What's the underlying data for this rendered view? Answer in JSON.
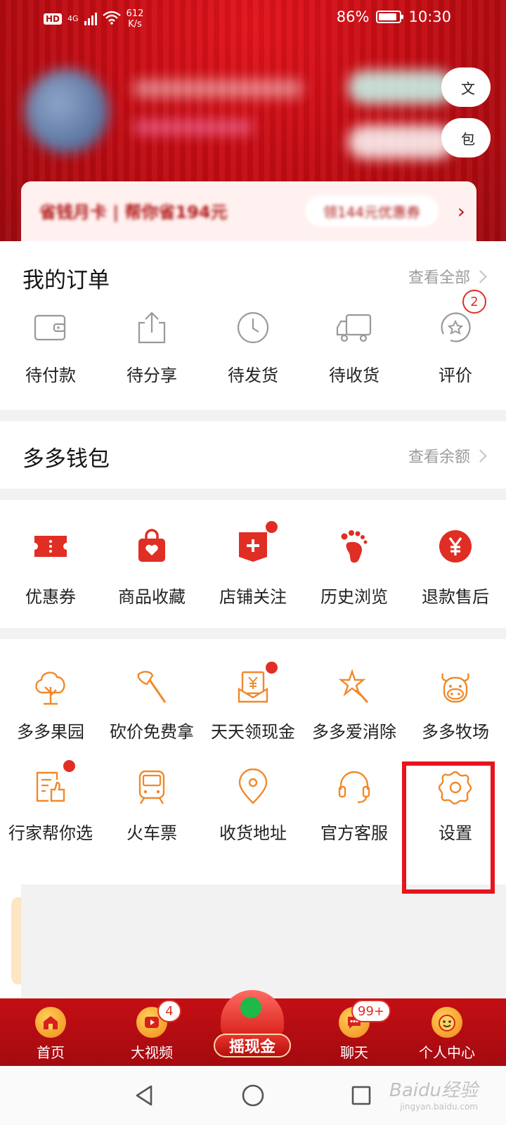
{
  "status_bar": {
    "hd": "HD",
    "network": "4G",
    "speed_value": "612",
    "speed_unit": "K/s",
    "battery": "86%",
    "battery_level": 0.86,
    "time": "10:30"
  },
  "profile": {
    "promo_text": "省钱月卡 | 帮你省194元",
    "promo_button": "领144元优惠券"
  },
  "orders": {
    "title": "我的订单",
    "view_all": "查看全部",
    "items": [
      {
        "label": "待付款",
        "icon": "wallet-icon"
      },
      {
        "label": "待分享",
        "icon": "share-icon"
      },
      {
        "label": "待发货",
        "icon": "clock-icon"
      },
      {
        "label": "待收货",
        "icon": "truck-icon"
      },
      {
        "label": "评价",
        "icon": "review-icon",
        "badge": "2"
      }
    ]
  },
  "wallet": {
    "title": "多多钱包",
    "view_balance": "查看余额"
  },
  "quick_links": [
    {
      "label": "优惠券",
      "icon": "coupon-icon"
    },
    {
      "label": "商品收藏",
      "icon": "favorites-bag-icon"
    },
    {
      "label": "店铺关注",
      "icon": "store-follow-icon",
      "dot": true
    },
    {
      "label": "历史浏览",
      "icon": "footprint-icon"
    },
    {
      "label": "退款售后",
      "icon": "refund-icon"
    }
  ],
  "services": [
    {
      "label": "多多果园",
      "icon": "tree-icon"
    },
    {
      "label": "砍价免费拿",
      "icon": "axe-icon"
    },
    {
      "label": "天天领现金",
      "icon": "cash-envelope-icon",
      "dot": true
    },
    {
      "label": "多多爱消除",
      "icon": "star-wand-icon"
    },
    {
      "label": "多多牧场",
      "icon": "cow-icon"
    },
    {
      "label": "行家帮你选",
      "icon": "thumbs-up-doc-icon",
      "dot": true
    },
    {
      "label": "火车票",
      "icon": "train-icon"
    },
    {
      "label": "收货地址",
      "icon": "location-pin-icon"
    },
    {
      "label": "官方客服",
      "icon": "headset-icon"
    },
    {
      "label": "设置",
      "icon": "gear-icon"
    }
  ],
  "bottom_nav": {
    "items": [
      {
        "label": "首页",
        "icon": "home-icon"
      },
      {
        "label": "大视频",
        "icon": "video-icon",
        "badge": "4"
      },
      {
        "label": "摇现金",
        "icon": "shake-cash-icon"
      },
      {
        "label": "聊天",
        "icon": "chat-icon",
        "badge": "99+"
      },
      {
        "label": "个人中心",
        "icon": "profile-icon"
      }
    ]
  },
  "watermark": {
    "text": "Baidu经验",
    "sub": "jingyan.baidu.com"
  },
  "colors": {
    "brand_red": "#e02e24",
    "icon_orange": "#f0892a",
    "header_red": "#c40c13",
    "highlight": "#e8141d"
  }
}
